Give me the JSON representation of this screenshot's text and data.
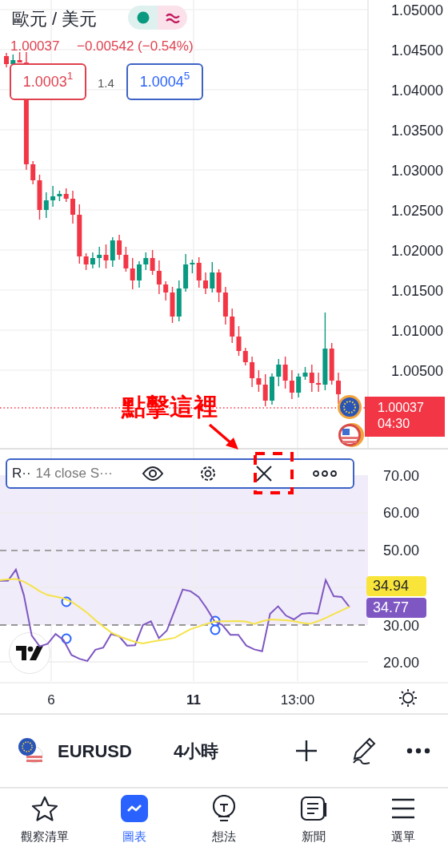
{
  "header": {
    "title": "歐元 / 美元",
    "last": "1.00037",
    "change": "−0.00542 (−0.54%)",
    "bid": "1.0003$^{1}$",
    "spread": "1.4",
    "ask": "1.0004$^{5}$"
  },
  "price_chart": {
    "chart_data": {
      "type": "candlestick",
      "ylim": [
        0.9952,
        1.0512
      ],
      "yticks": [
        {
          "value": 1.005,
          "label": "1.00500"
        },
        {
          "value": 1.01,
          "label": "1.01000"
        },
        {
          "value": 1.015,
          "label": "1.01500"
        },
        {
          "value": 1.02,
          "label": "1.02000"
        },
        {
          "value": 1.025,
          "label": "1.02500"
        },
        {
          "value": 1.03,
          "label": "1.03000"
        },
        {
          "value": 1.035,
          "label": "1.03500"
        },
        {
          "value": 1.04,
          "label": "1.04000"
        },
        {
          "value": 1.045,
          "label": "1.04500"
        },
        {
          "value": 1.05,
          "label": "1.05000"
        }
      ],
      "ohlc": [
        [
          1.0442,
          1.0446,
          1.0428,
          1.0432
        ],
        [
          1.0432,
          1.0444,
          1.0432,
          1.0437
        ],
        [
          1.0437,
          1.0447,
          1.0434,
          1.0434
        ],
        [
          1.0434,
          1.0447,
          1.03,
          1.0307
        ],
        [
          1.0307,
          1.0311,
          1.0282,
          1.0287
        ],
        [
          1.0287,
          1.0294,
          1.0238,
          1.025
        ],
        [
          1.025,
          1.0272,
          1.024,
          1.0262
        ],
        [
          1.0262,
          1.028,
          1.0254,
          1.0267
        ],
        [
          1.0267,
          1.0274,
          1.0261,
          1.027
        ],
        [
          1.027,
          1.0277,
          1.026,
          1.0264
        ],
        [
          1.0264,
          1.0274,
          1.0233,
          1.0244
        ],
        [
          1.0244,
          1.0257,
          1.0183,
          1.0192
        ],
        [
          1.0192,
          1.0196,
          1.0175,
          1.0182
        ],
        [
          1.0182,
          1.0197,
          1.0177,
          1.019
        ],
        [
          1.019,
          1.0204,
          1.0178,
          1.0194
        ],
        [
          1.0194,
          1.0207,
          1.0177,
          1.0187
        ],
        [
          1.0187,
          1.0216,
          1.0179,
          1.0212
        ],
        [
          1.0212,
          1.0219,
          1.0188,
          1.0194
        ],
        [
          1.0194,
          1.0204,
          1.0173,
          1.0177
        ],
        [
          1.0177,
          1.019,
          1.0151,
          1.0162
        ],
        [
          1.0162,
          1.0186,
          1.0153,
          1.0182
        ],
        [
          1.0182,
          1.0197,
          1.0175,
          1.019
        ],
        [
          1.019,
          1.02,
          1.0169,
          1.0174
        ],
        [
          1.0174,
          1.0187,
          1.0145,
          1.0157
        ],
        [
          1.0157,
          1.0161,
          1.0137,
          1.0147
        ],
        [
          1.0147,
          1.0154,
          1.0109,
          1.0117
        ],
        [
          1.0117,
          1.0162,
          1.0111,
          1.0152
        ],
        [
          1.0152,
          1.0195,
          1.0148,
          1.0182
        ],
        [
          1.0182,
          1.0188,
          1.0171,
          1.0184
        ],
        [
          1.0184,
          1.0191,
          1.0153,
          1.0162
        ],
        [
          1.0162,
          1.0172,
          1.0145,
          1.0152
        ],
        [
          1.0152,
          1.0185,
          1.0147,
          1.0172
        ],
        [
          1.0172,
          1.0176,
          1.0135,
          1.0147
        ],
        [
          1.0147,
          1.0154,
          1.0107,
          1.0117
        ],
        [
          1.0117,
          1.0127,
          1.0084,
          1.0092
        ],
        [
          1.0092,
          1.0105,
          1.0068,
          1.0074
        ],
        [
          1.0074,
          1.0078,
          1.0056,
          1.006
        ],
        [
          1.006,
          1.0067,
          1.0029,
          1.004
        ],
        [
          1.004,
          1.005,
          1.0023,
          1.0032
        ],
        [
          1.0032,
          1.0045,
          1.0005,
          1.0012
        ],
        [
          1.0012,
          1.0046,
          1.0007,
          1.0042
        ],
        [
          1.0042,
          1.0064,
          1.003,
          1.0057
        ],
        [
          1.0057,
          1.0067,
          1.0027,
          1.0037
        ],
        [
          1.0037,
          1.005,
          1.0014,
          1.0022
        ],
        [
          1.0022,
          1.0046,
          1.0016,
          1.0042
        ],
        [
          1.0042,
          1.0054,
          1.0038,
          1.0047
        ],
        [
          1.0047,
          1.0057,
          1.0023,
          1.0034
        ],
        [
          1.0034,
          1.0047,
          1.0023,
          1.0032
        ],
        [
          1.0032,
          1.0122,
          1.0025,
          1.0077
        ],
        [
          1.0077,
          1.0084,
          1.0032,
          1.0037
        ],
        [
          1.0037,
          1.0047,
          1.0008,
          1.002
        ]
      ]
    }
  },
  "last_price_label": {
    "price": "1.00037",
    "countdown": "04:30"
  },
  "annotation": {
    "text": "點擊這裡"
  },
  "indicator_bar": {
    "name": "R··",
    "params": "14 close S···"
  },
  "rsi_chart": {
    "chart_data": {
      "type": "line",
      "ylim": [
        20,
        70
      ],
      "yticks": [
        {
          "value": 20,
          "label": "20.00"
        },
        {
          "value": 30,
          "label": "30.00"
        },
        {
          "value": 50,
          "label": "50.00"
        },
        {
          "value": 60,
          "label": "60.00"
        },
        {
          "value": 70,
          "label": "70.00"
        }
      ],
      "series": [
        {
          "color": "#7e57c2",
          "values": [
            41.8,
            41.8,
            44.8,
            38.0,
            27.2,
            24.3,
            25.0,
            27.6,
            26.0,
            22.0,
            21.0,
            20.4,
            23.4,
            24.0,
            27.6,
            27.0,
            24.5,
            24.6,
            30.0,
            31.0,
            26.5,
            28.5,
            34.0,
            39.5,
            39.0,
            37.5,
            34.5,
            31.0,
            30.0,
            27.4,
            27.4,
            24.5,
            23.5,
            23.0,
            33.0,
            35.0,
            32.5,
            31.5,
            33.0,
            33.2,
            33.0,
            42.0,
            37.7,
            37.5,
            34.8
          ]
        },
        {
          "color": "#f5e34a",
          "values": [
            42.0,
            42.2,
            42.3,
            41.6,
            40.4,
            39.0,
            38.0,
            37.6,
            37.1,
            36.2,
            34.8,
            33.2,
            31.3,
            29.6,
            28.0,
            27.0,
            26.2,
            25.5,
            25.1,
            25.5,
            25.9,
            26.2,
            26.6,
            27.8,
            28.9,
            29.6,
            30.3,
            30.9,
            31.0,
            31.0,
            31.1,
            30.9,
            30.3,
            31.0,
            31.5,
            31.4,
            31.3,
            31.0,
            30.6,
            30.3,
            31.0,
            31.9,
            32.9,
            33.9,
            34.9
          ]
        }
      ]
    }
  },
  "time_axis": [
    {
      "label": "6",
      "bold": false
    },
    {
      "label": "11",
      "bold": true
    },
    {
      "label": "13:00",
      "bold": false
    }
  ],
  "rsi_labels": [
    {
      "value": "34.94",
      "color": "#f9e53a"
    },
    {
      "value": "34.77",
      "color": "#7e57c2"
    }
  ],
  "toolbar": {
    "symbol": "EURUSD",
    "interval": "4小時"
  },
  "nav": [
    {
      "label": "觀察清單",
      "selected": false
    },
    {
      "label": "圖表",
      "selected": true
    },
    {
      "label": "想法",
      "selected": false
    },
    {
      "label": "新聞",
      "selected": false
    },
    {
      "label": "選單",
      "selected": false
    }
  ]
}
